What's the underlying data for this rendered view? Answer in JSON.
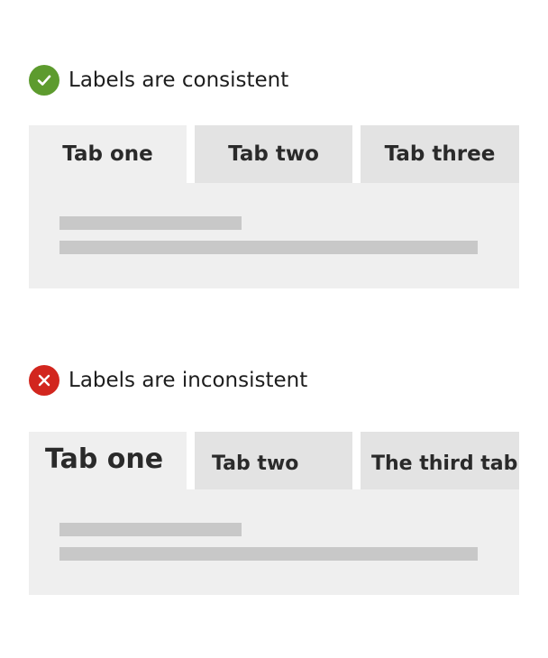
{
  "good_example": {
    "heading": "Labels are consistent",
    "status_color": "#5d9b2e",
    "icon": "checkmark-icon",
    "tabs": [
      "Tab one",
      "Tab two",
      "Tab three"
    ]
  },
  "bad_example": {
    "heading": "Labels are inconsistent",
    "status_color": "#d2261e",
    "icon": "cross-icon",
    "tabs": [
      "Tab one",
      "Tab two",
      "The third tab"
    ]
  },
  "colors": {
    "panel": "#efefef",
    "inactive_tab": "#e3e3e3",
    "placeholder_line": "#c8c8c8"
  }
}
